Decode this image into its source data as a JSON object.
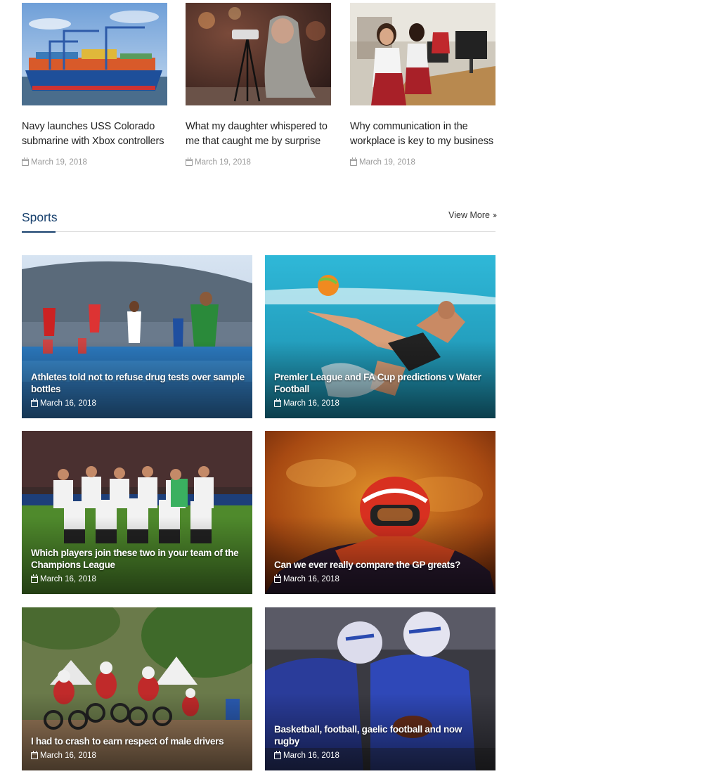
{
  "top_articles": [
    {
      "title": "Navy launches USS Colorado submarine with Xbox controllers",
      "date": "March 19, 2018",
      "image": "cargo-ship-port"
    },
    {
      "title": "What my daughter whispered to me that caught me by surprise",
      "date": "March 19, 2018",
      "image": "girl-camera-tripod"
    },
    {
      "title": "Why communication in the workplace is key to my business",
      "date": "March 19, 2018",
      "image": "students-computers"
    }
  ],
  "sports": {
    "heading": "Sports",
    "view_more": "View More",
    "accent_color": "#17406d",
    "items": [
      {
        "title": "Athletes told not to refuse drug tests over sample bottles",
        "date": "March 16, 2018",
        "image": "steeplechase-runners"
      },
      {
        "title": "Premler League and FA Cup predictions v Water Football",
        "date": "March 16, 2018",
        "image": "beach-bicycle-kick"
      },
      {
        "title": "Which players join these two in your team of the Champions League",
        "date": "March 16, 2018",
        "image": "football-team-photo"
      },
      {
        "title": "Can we ever really compare the GP greats?",
        "date": "March 16, 2018",
        "image": "motocross-helmet-rider"
      },
      {
        "title": "I had to crash to earn respect of male drivers",
        "date": "March 16, 2018",
        "image": "motocross-race"
      },
      {
        "title": "Basketball, football, gaelic football and now rugby",
        "date": "March 16, 2018",
        "image": "american-football-players"
      }
    ]
  }
}
